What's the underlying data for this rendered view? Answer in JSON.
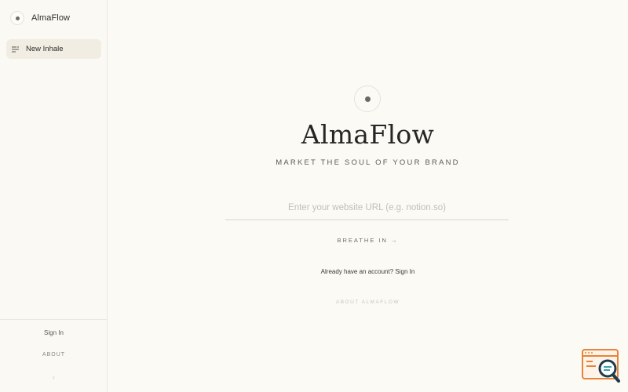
{
  "sidebar": {
    "brand_name": "AlmaFlow",
    "new_inhale_label": "New Inhale",
    "sign_in_label": "Sign In",
    "about_label": "ABOUT",
    "collapse_glyph": "‹"
  },
  "main": {
    "title": "AlmaFlow",
    "tagline": "MARKET THE SOUL OF YOUR BRAND",
    "url_placeholder": "Enter your website URL (e.g. notion.so)",
    "breathe_label": "BREATHE IN →",
    "account_prompt": "Already have an account?",
    "account_sign_in": "Sign In",
    "about_label": "ABOUT ALMAFLOW"
  },
  "icons": {
    "brand": "dot-circle-icon",
    "new_inhale": "new-chat-icon",
    "widget": "search-browser-icon"
  },
  "colors": {
    "background": "#fcfaf5",
    "sidebar_active": "#f1ede3",
    "widget_accent": "#e8833a",
    "widget_dark": "#1f3a4d"
  }
}
